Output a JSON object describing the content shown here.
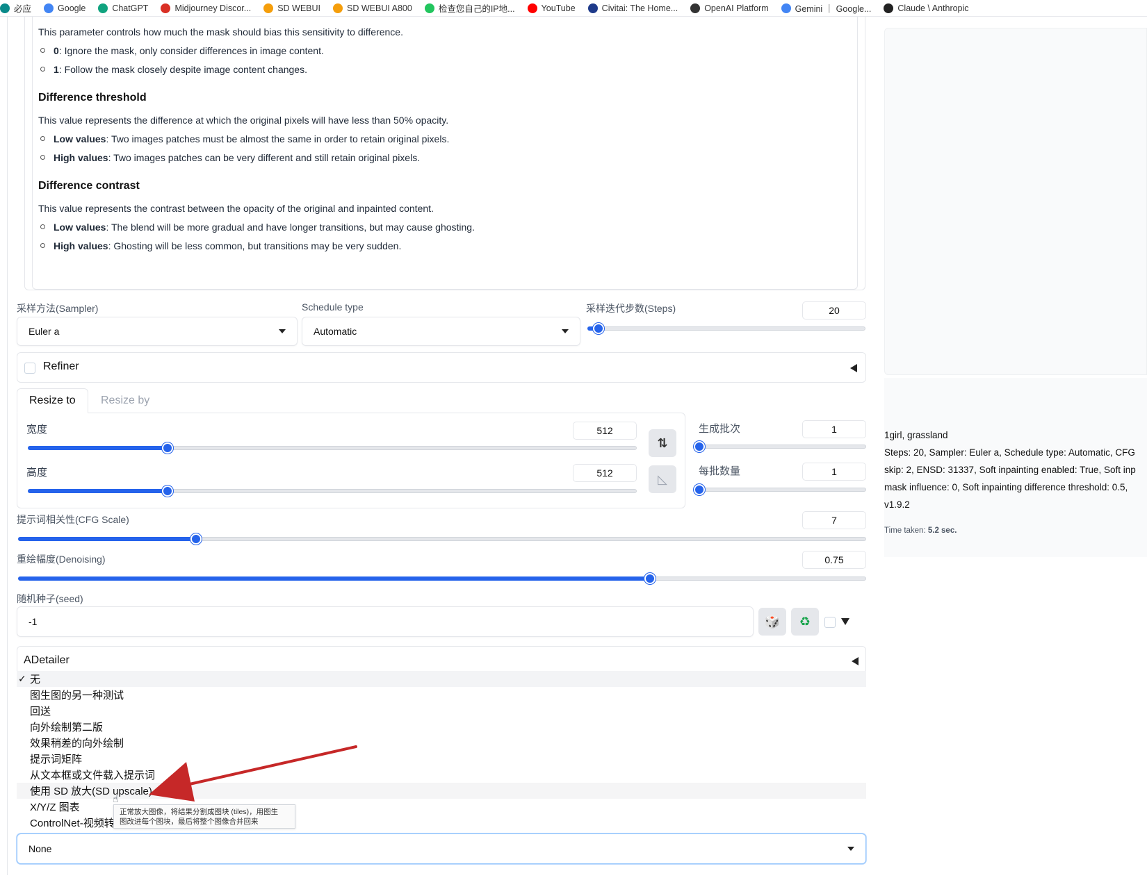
{
  "bookmarks": [
    {
      "label": "必应",
      "icon": "bing-icon",
      "color": "#0a8a8a"
    },
    {
      "label": "Google",
      "icon": "google-icon",
      "color": "#4285f4"
    },
    {
      "label": "ChatGPT",
      "icon": "chatgpt-icon",
      "color": "#10a37f"
    },
    {
      "label": "Midjourney Discor...",
      "icon": "midjourney-icon",
      "color": "#d93025"
    },
    {
      "label": "SD WEBUI",
      "icon": "sd-webui-icon",
      "color": "#f59e0b"
    },
    {
      "label": "SD WEBUI A800",
      "icon": "sd-webui-a800-icon",
      "color": "#f59e0b"
    },
    {
      "label": "检查您自己的IP地...",
      "icon": "ip-check-icon",
      "color": "#22c55e"
    },
    {
      "label": "YouTube",
      "icon": "youtube-icon",
      "color": "#ff0000"
    },
    {
      "label": "Civitai: The Home...",
      "icon": "civitai-icon",
      "color": "#1e3a8a"
    },
    {
      "label": "OpenAI Platform",
      "icon": "openai-icon",
      "color": "#333333"
    },
    {
      "label": "Gemini ｜ Google...",
      "icon": "gemini-icon",
      "color": "#4285f4"
    },
    {
      "label": "Claude \\ Anthropic",
      "icon": "anthropic-icon",
      "color": "#222222"
    }
  ],
  "doc": {
    "intro": "This parameter controls how much the mask should bias this sensitivity to difference.",
    "intro_items": [
      {
        "bold": "0",
        "text": ": Ignore the mask, only consider differences in image content."
      },
      {
        "bold": "1",
        "text": ": Follow the mask closely despite image content changes."
      }
    ],
    "threshold_title": "Difference threshold",
    "threshold_desc": "This value represents the difference at which the original pixels will have less than 50% opacity.",
    "threshold_items": [
      {
        "bold": "Low values",
        "text": ": Two images patches must be almost the same in order to retain original pixels."
      },
      {
        "bold": "High values",
        "text": ": Two images patches can be very different and still retain original pixels."
      }
    ],
    "contrast_title": "Difference contrast",
    "contrast_desc": "This value represents the contrast between the opacity of the original and inpainted content.",
    "contrast_items": [
      {
        "bold": "Low values",
        "text": ": The blend will be more gradual and have longer transitions, but may cause ghosting."
      },
      {
        "bold": "High values",
        "text": ": Ghosting will be less common, but transitions may be very sudden."
      }
    ]
  },
  "sampler": {
    "label": "采样方法(Sampler)",
    "value": "Euler a"
  },
  "schedule": {
    "label": "Schedule type",
    "value": "Automatic"
  },
  "steps": {
    "label": "采样迭代步数(Steps)",
    "value": "20",
    "fraction": 0.04
  },
  "refiner": {
    "label": "Refiner"
  },
  "tabs": {
    "resize_to": "Resize to",
    "resize_by": "Resize by"
  },
  "width": {
    "label": "宽度",
    "value": "512",
    "fraction": 0.23
  },
  "height": {
    "label": "高度",
    "value": "512",
    "fraction": 0.23
  },
  "batch_count": {
    "label": "生成批次",
    "value": "1",
    "fraction": 0.0
  },
  "batch_size": {
    "label": "每批数量",
    "value": "1",
    "fraction": 0.0
  },
  "cfg": {
    "label": "提示词相关性(CFG Scale)",
    "value": "7",
    "fraction": 0.21
  },
  "denoising": {
    "label": "重绘幅度(Denoising)",
    "value": "0.75",
    "fraction": 0.745
  },
  "seed": {
    "label": "随机种子(seed)",
    "value": "-1"
  },
  "adetailer": {
    "label": "ADetailer"
  },
  "script_menu": {
    "items": [
      "无",
      "图生图的另一种测试",
      "回送",
      "向外绘制第二版",
      "效果稍差的向外绘制",
      "提示词矩阵",
      "从文本框或文件载入提示词",
      "使用 SD 放大(SD upscale)",
      "X/Y/Z 图表",
      "ControlNet-视频转"
    ],
    "check_mark": "✓",
    "tooltip_line1": "正常放大图像，将结果分割成图块 (tiles)，用图生",
    "tooltip_line2": "图改进每个图块，最后将整个图像合并回来"
  },
  "script_select": {
    "value": "None"
  },
  "output": {
    "prompt": "1girl, grassland",
    "params_line1": "Steps: 20, Sampler: Euler a, Schedule type: Automatic, CFG",
    "params_line2": "skip: 2, ENSD: 31337, Soft inpainting enabled: True, Soft inp",
    "params_line3": "mask influence: 0, Soft inpainting difference threshold: 0.5,",
    "params_line4": "v1.9.2",
    "time_label": "Time taken: ",
    "time_value": "5.2 sec."
  },
  "colors": {
    "accent": "#2563eb",
    "arrow": "#c62828"
  }
}
